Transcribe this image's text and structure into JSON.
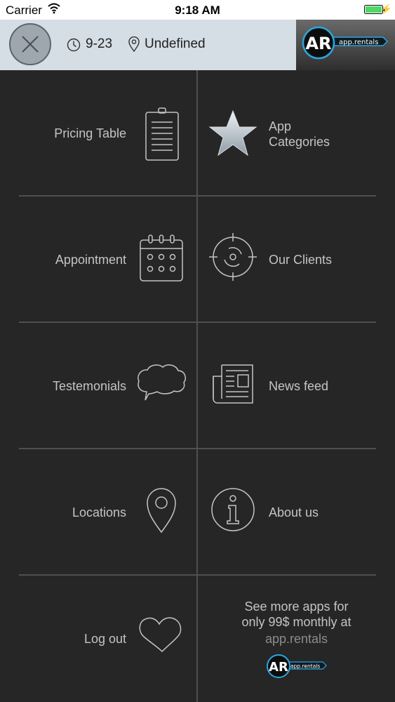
{
  "status_bar": {
    "carrier": "Carrier",
    "time": "9:18 AM"
  },
  "header": {
    "time_value": "9-23",
    "location_value": "Undefined",
    "logo_mark": "AR",
    "logo_text": "app.rentals"
  },
  "menu": {
    "pricing_table": "Pricing Table",
    "app_categories_line1": "App",
    "app_categories_line2": "Categories",
    "appointment": "Appointment",
    "our_clients": "Our Clients",
    "testemonials": "Testemonials",
    "news_feed": "News feed",
    "locations": "Locations",
    "about_us": "About us",
    "log_out": "Log out"
  },
  "promo": {
    "line1": "See more apps for",
    "line2": "only 99$ monthly at",
    "link": "app.rentals",
    "logo_mark": "AR",
    "logo_text": "app.rentals"
  },
  "colors": {
    "background": "#262626",
    "header": "#d5dde5",
    "text": "#c4c4c4",
    "battery": "#4cd964",
    "brand_blue": "#2aa6dd"
  }
}
